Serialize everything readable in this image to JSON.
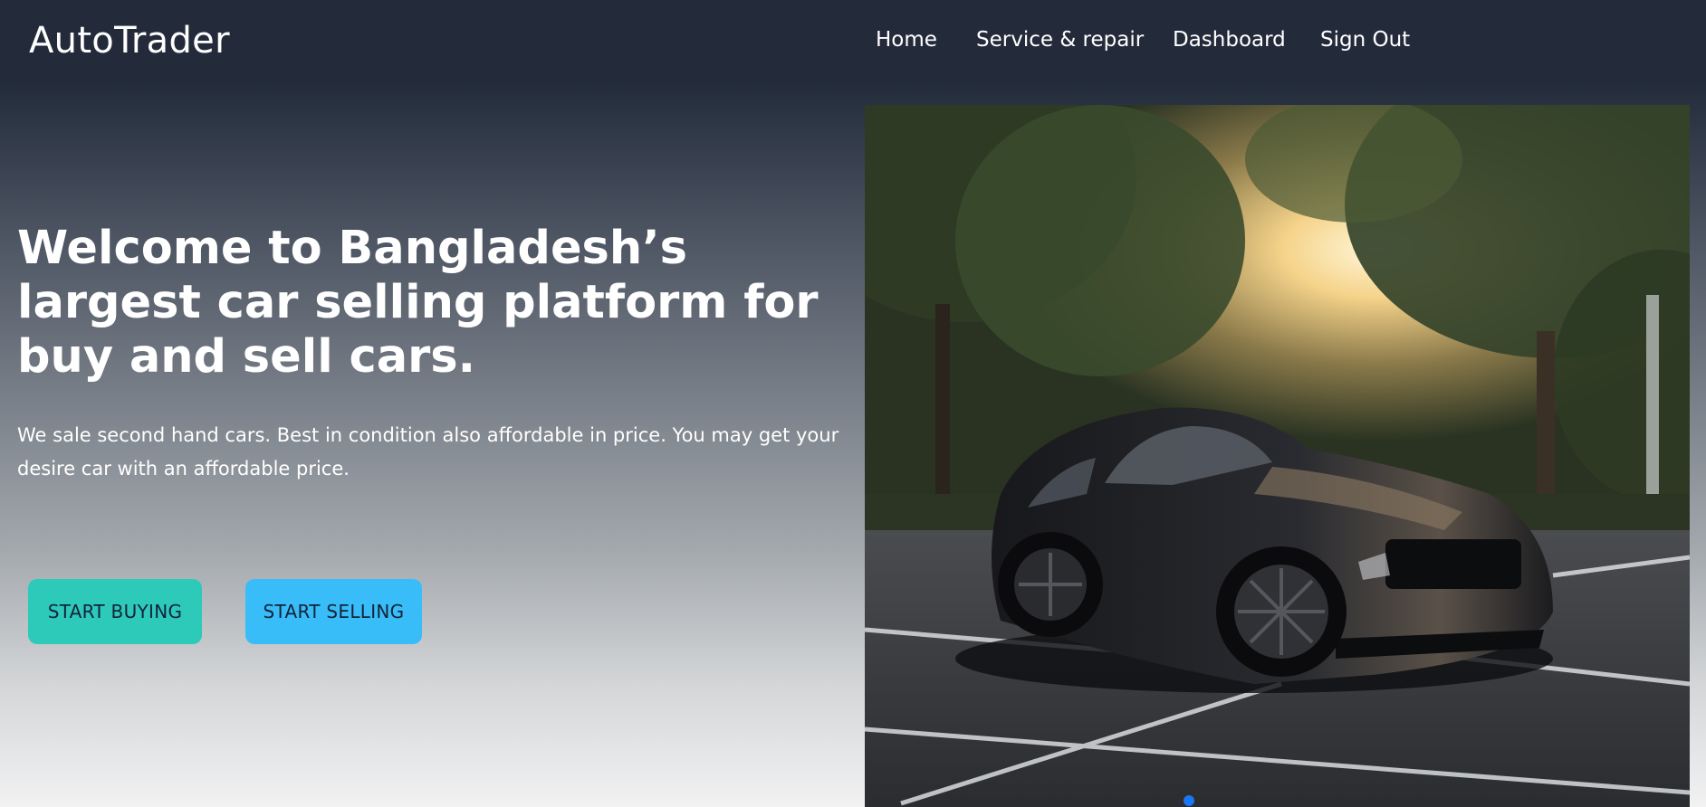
{
  "navbar": {
    "brand": "AutoTrader",
    "links": [
      {
        "label": "Home"
      },
      {
        "label": "Service & repair"
      },
      {
        "label": "Dashboard"
      },
      {
        "label": "Sign Out"
      }
    ]
  },
  "hero": {
    "title": "Welcome to Bangladesh’s largest car selling platform for buy and sell cars.",
    "description": "We sale second hand cars. Best in condition also affordable in price. You may get your desire car with an affordable price.",
    "buy_label": "START BUYING",
    "sell_label": "START SELLING"
  },
  "carousel": {
    "slide_count": 1,
    "active_index": 0,
    "active_dot_color": "#1a76f2"
  },
  "colors": {
    "navbar_bg": "#232b3b",
    "buy_button": "#2dcab9",
    "sell_button": "#38bdf8"
  }
}
